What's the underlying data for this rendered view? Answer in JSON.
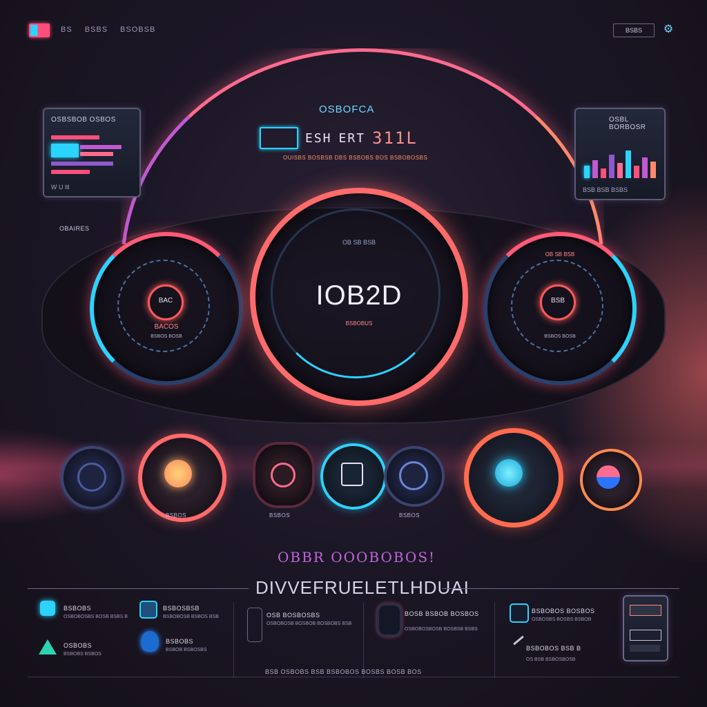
{
  "topbar": {
    "nav": [
      "BS",
      "BSBS",
      "BSOBSB"
    ],
    "badge": "BSBS",
    "icon": "settings-icon"
  },
  "header": {
    "title": "OSBOFCA",
    "segments": [
      "ESH",
      "ERT"
    ],
    "value": "311L",
    "subtitle": "OUISBS BOSBSB DBS BSBOBS BOS BSBOBOSBS"
  },
  "left_panel": {
    "title": "OSBSBOB OSBOS",
    "foot": "W U ltl"
  },
  "right_panel": {
    "title": "OSBL BORBOSR",
    "foot": "BSB BSB BSBS"
  },
  "side_label": "OBAIRES",
  "gauges": {
    "left": {
      "center": "BAC",
      "label": "BACOS",
      "sub": "BSBOS BOSB"
    },
    "main": {
      "value": "IOB2D",
      "label": "BSBOBUS",
      "top": "OB SB BSB"
    },
    "right": {
      "top": "OB SB BSB",
      "center": "BSB",
      "sub": "BSBOS BOSB"
    }
  },
  "orbs": [
    {
      "label": ""
    },
    {
      "label": "BSBOS"
    },
    {
      "label": "BSBOS"
    },
    {
      "label": ""
    },
    {
      "label": "BSBOS"
    },
    {
      "label": ""
    },
    {
      "label": ""
    }
  ],
  "tagline": {
    "line1": "OBBR OOOBOBOS!",
    "line2": "DIVVEFRUELETLHDUAI"
  },
  "features": [
    {
      "title": "BSBOBS",
      "sub": "OSBOBOSBS BOSB BSBS B",
      "icon": "cyan-square-icon"
    },
    {
      "title": "BSBOSBSB",
      "sub": "BSBOBOSB BSBOS BSB",
      "icon": "bookmark-icon"
    },
    {
      "title": "OSBOBS",
      "sub": "BSBOBS BSBOS",
      "icon": "triangle-icon"
    },
    {
      "title": "BSBOBS",
      "sub": "BSBOB BSBOSBS",
      "icon": "shield-icon"
    },
    {
      "title": "OSB BOSBOSBS",
      "sub": "OSBOBOSB BOSBOB BOSBOBS BSB",
      "icon": "doc-icon"
    },
    {
      "title": "BOSB BSBOB BOSBOS",
      "sub": "OSBOBOSBOSB BOSBSB BSBS",
      "icon": "headset-icon"
    },
    {
      "title": "BSBOBOS BOSBOS",
      "sub": "OSBOSBS BOSBS BSBOB",
      "icon": "cube-icon"
    },
    {
      "title": "BSBOBOS BSB B",
      "sub": "OS BSB BSBOSBOSB",
      "icon": "pen-icon"
    }
  ],
  "footer": "BSB OSBOBS BSB BSBOBOS BOSBS BOSB BOS",
  "colors": {
    "accent_pink": "#ff6b8f",
    "accent_cyan": "#2bd3ff",
    "accent_orange": "#ff8a6b",
    "background": "#1c1726"
  }
}
